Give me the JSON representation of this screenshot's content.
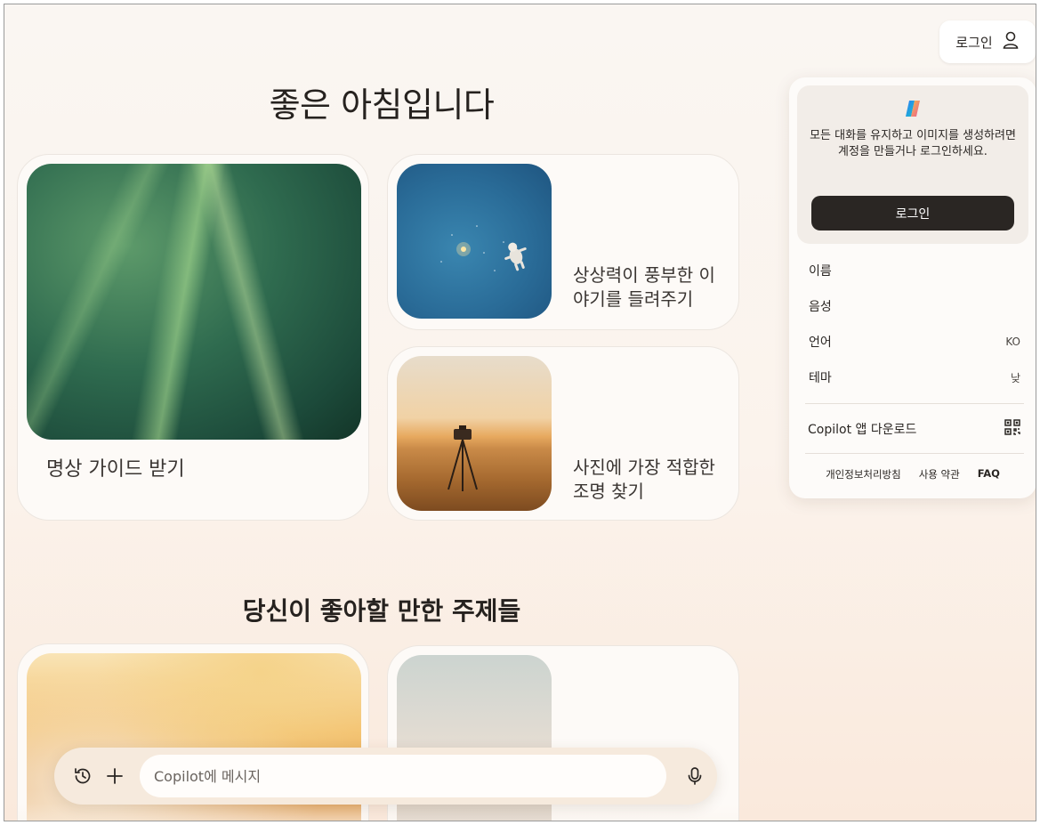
{
  "greeting": "좋은 아침입니다",
  "cards": [
    {
      "label": "명상 가이드 받기",
      "image": "green-grass-blades"
    },
    {
      "label": "상상력이 풍부한 이야기를 들려주기",
      "image": "astronaut-in-blue-space"
    },
    {
      "label": "사진에 가장 적합한 조명 찾기",
      "image": "camera-tripod-in-golden-field"
    }
  ],
  "topics_title": "당신이 좋아할 만한 주제들",
  "topic_cards": [
    {
      "image": "warm-sunlight-flare"
    },
    {
      "image": "pale-seascape"
    }
  ],
  "header": {
    "login_label": "로그인"
  },
  "panel": {
    "promo_message": "모든 대화를 유지하고 이미지를 생성하려면 계정을 만들거나 로그인하세요.",
    "login_button": "로그인",
    "menu": [
      {
        "label": "이름",
        "value": ""
      },
      {
        "label": "음성",
        "value": ""
      },
      {
        "label": "언어",
        "value": "KO"
      },
      {
        "label": "테마",
        "value": "낮"
      }
    ],
    "download_label": "Copilot 앱 다운로드",
    "footer": {
      "privacy": "개인정보처리방침",
      "terms": "사용 약관",
      "faq": "FAQ"
    }
  },
  "composer": {
    "placeholder": "Copilot에 메시지"
  },
  "icons": {
    "history": "history-icon",
    "add": "plus-icon",
    "mic": "microphone-icon",
    "user": "user-icon",
    "qr": "qr-code-icon",
    "logo": "copilot-logo-icon"
  }
}
